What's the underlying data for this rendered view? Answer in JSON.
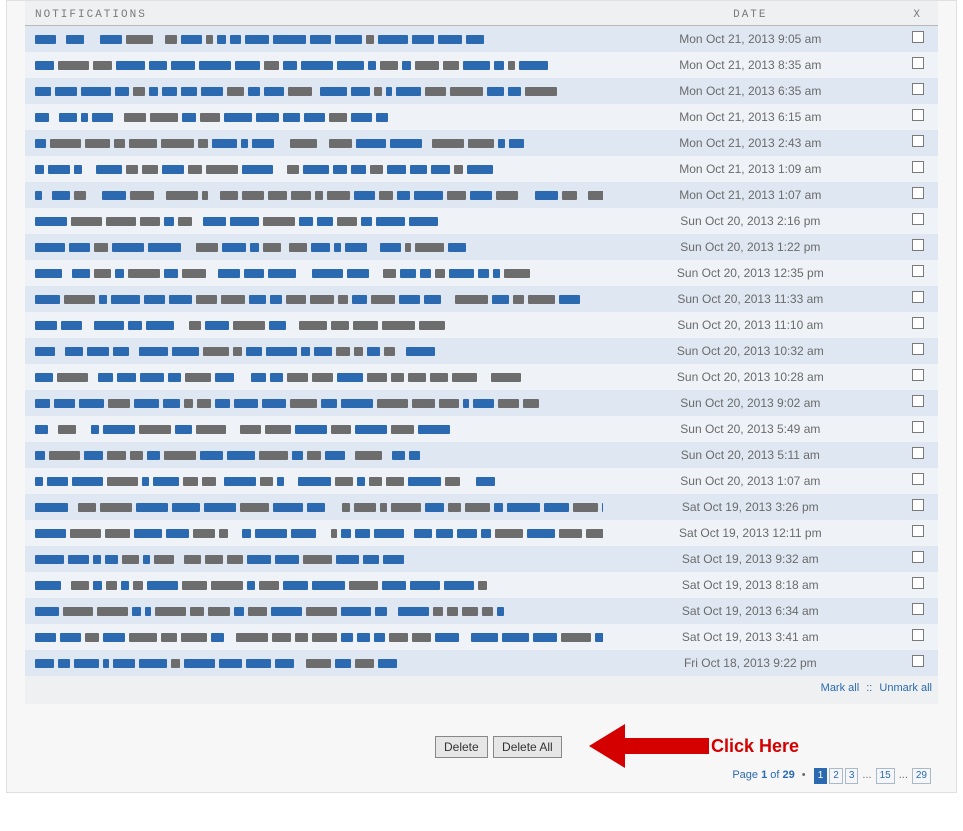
{
  "headers": {
    "notifications": "NOTIFICATIONS",
    "date": "DATE",
    "x": "X"
  },
  "rows": [
    {
      "date": "Mon Oct 21, 2013 9:05 am",
      "variant": 0
    },
    {
      "date": "Mon Oct 21, 2013 8:35 am",
      "variant": 1
    },
    {
      "date": "Mon Oct 21, 2013 6:35 am",
      "variant": 2
    },
    {
      "date": "Mon Oct 21, 2013 6:15 am",
      "variant": 3
    },
    {
      "date": "Mon Oct 21, 2013 2:43 am",
      "variant": 4
    },
    {
      "date": "Mon Oct 21, 2013 1:09 am",
      "variant": 5
    },
    {
      "date": "Mon Oct 21, 2013 1:07 am",
      "variant": 6
    },
    {
      "date": "Sun Oct 20, 2013 2:16 pm",
      "variant": 7
    },
    {
      "date": "Sun Oct 20, 2013 1:22 pm",
      "variant": 8
    },
    {
      "date": "Sun Oct 20, 2013 12:35 pm",
      "variant": 9
    },
    {
      "date": "Sun Oct 20, 2013 11:33 am",
      "variant": 10
    },
    {
      "date": "Sun Oct 20, 2013 11:10 am",
      "variant": 11
    },
    {
      "date": "Sun Oct 20, 2013 10:32 am",
      "variant": 12
    },
    {
      "date": "Sun Oct 20, 2013 10:28 am",
      "variant": 13
    },
    {
      "date": "Sun Oct 20, 2013 9:02 am",
      "variant": 14
    },
    {
      "date": "Sun Oct 20, 2013 5:49 am",
      "variant": 15
    },
    {
      "date": "Sun Oct 20, 2013 5:11 am",
      "variant": 16
    },
    {
      "date": "Sun Oct 20, 2013 1:07 am",
      "variant": 17
    },
    {
      "date": "Sat Oct 19, 2013 3:26 pm",
      "variant": 18
    },
    {
      "date": "Sat Oct 19, 2013 12:11 pm",
      "variant": 19
    },
    {
      "date": "Sat Oct 19, 2013 9:32 am",
      "variant": 20
    },
    {
      "date": "Sat Oct 19, 2013 8:18 am",
      "variant": 21
    },
    {
      "date": "Sat Oct 19, 2013 6:34 am",
      "variant": 22
    },
    {
      "date": "Sat Oct 19, 2013 3:41 am",
      "variant": 23
    },
    {
      "date": "Fri Oct 18, 2013 9:22 pm",
      "variant": 24
    }
  ],
  "mark": {
    "mark_all": "Mark all",
    "unmark_all": "Unmark all"
  },
  "buttons": {
    "delete": "Delete",
    "delete_all": "Delete All"
  },
  "annotation": {
    "click_here": "Click Here"
  },
  "pager": {
    "label_prefix": "Page ",
    "current": "1",
    "label_mid": " of ",
    "total": "29",
    "pages": [
      {
        "n": "1",
        "current": true
      },
      {
        "n": "2",
        "current": false
      },
      {
        "n": "3",
        "current": false
      }
    ],
    "ellipsis": "...",
    "mid_page": {
      "n": "15",
      "current": false
    },
    "last_page": {
      "n": "29",
      "current": false
    }
  }
}
